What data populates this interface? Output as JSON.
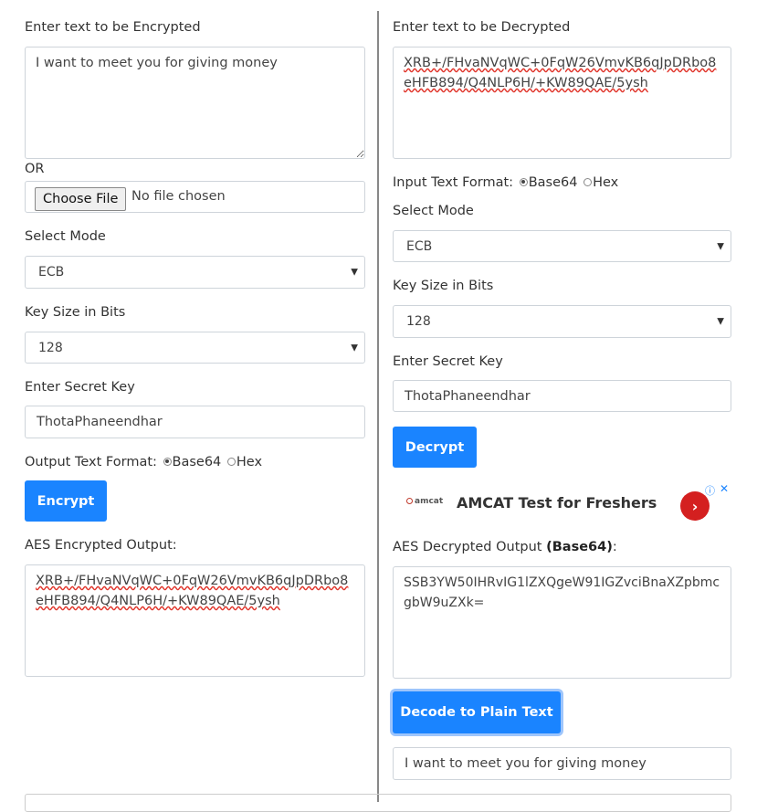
{
  "encrypt": {
    "input_label": "Enter text to be Encrypted",
    "input_value": "I want to meet you for giving money",
    "or_label": "OR",
    "file_button": "Choose File",
    "file_status": "No file chosen",
    "mode_label": "Select Mode",
    "mode_value": "ECB",
    "keysize_label": "Key Size in Bits",
    "keysize_value": "128",
    "secret_label": "Enter Secret Key",
    "secret_value": "ThotaPhaneendhar",
    "format_label": "Output Text Format:",
    "format_options": [
      "Base64",
      "Hex"
    ],
    "format_selected": "Base64",
    "button": "Encrypt",
    "output_label": "AES Encrypted Output:",
    "output_lines": [
      "XRB+/FHvaNVqWC+0FqW26VmvKB6qJpDRbo8",
      "eHFB894/Q4NLP6H/+KW89QAE/5ysh"
    ]
  },
  "decrypt": {
    "input_label": "Enter text to be Decrypted",
    "input_lines": [
      "XRB+/FHvaNVqWC+0FqW26VmvKB6qJpDRbo8",
      "eHFB894/Q4NLP6H/+KW89QAE/5ysh"
    ],
    "format_label": "Input Text Format:",
    "format_options": [
      "Base64",
      "Hex"
    ],
    "format_selected": "Base64",
    "mode_label": "Select Mode",
    "mode_value": "ECB",
    "keysize_label": "Key Size in Bits",
    "keysize_value": "128",
    "secret_label": "Enter Secret Key",
    "secret_value": "ThotaPhaneendhar",
    "button": "Decrypt",
    "output_label": "AES Decrypted Output",
    "output_format": "(Base64)",
    "output_colon": ":",
    "output_lines": [
      "SSB3YW50IHRvIG1lZXQgeW91IGZvciBnaXZpbmc",
      "gbW9uZXk="
    ],
    "decode_button": "Decode to Plain Text",
    "plain_text": "I want to meet you for giving money"
  },
  "ad": {
    "logo": "amcat",
    "title": "AMCAT Test for Freshers",
    "info_icon": "info-icon",
    "close_icon": "close-icon"
  },
  "colors": {
    "accent": "#1a84ff",
    "ad_arrow": "#d42020",
    "spell_underline": "#e0342a"
  }
}
